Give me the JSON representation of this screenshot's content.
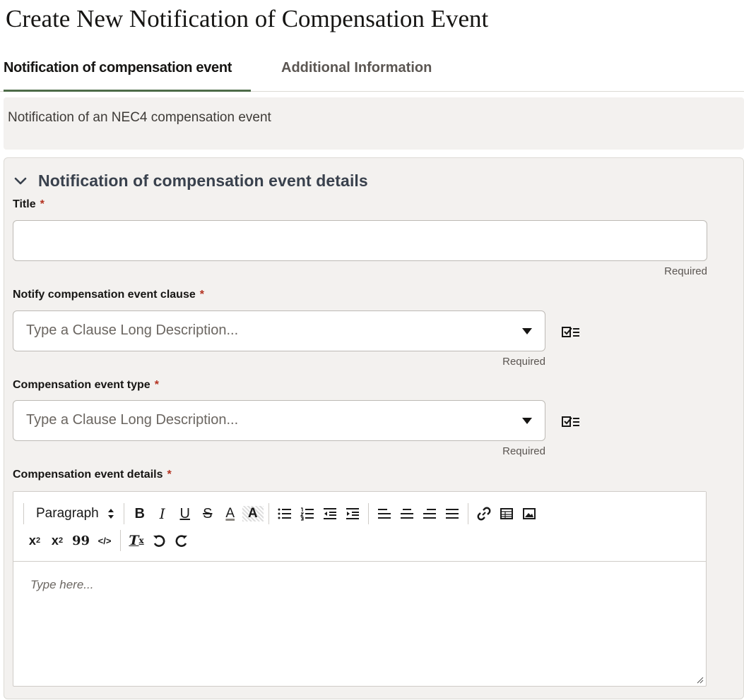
{
  "page": {
    "title": "Create New Notification of Compensation Event"
  },
  "tabs": [
    {
      "label": "Notification of compensation event",
      "active": true
    },
    {
      "label": "Additional Information",
      "active": false
    }
  ],
  "banner": {
    "text": "Notification of an NEC4 compensation event"
  },
  "section": {
    "title": "Notification of compensation event details",
    "expanded": true
  },
  "fields": {
    "title": {
      "label": "Title",
      "required_mark": "*",
      "value": "",
      "placeholder": "",
      "helper": "Required"
    },
    "clause": {
      "label": "Notify compensation event clause",
      "required_mark": "*",
      "placeholder": "Type a Clause Long Description...",
      "helper": "Required"
    },
    "event_type": {
      "label": "Compensation event type",
      "required_mark": "*",
      "placeholder": "Type a Clause Long Description...",
      "helper": "Required"
    },
    "details": {
      "label": "Compensation event details",
      "required_mark": "*",
      "placeholder": "Type here..."
    }
  },
  "editor": {
    "paragraph_label": "Paragraph",
    "toolbar_icons": [
      "bold-icon",
      "italic-icon",
      "underline-icon",
      "strikethrough-icon",
      "font-color-icon",
      "highlight-icon",
      "bullet-list-icon",
      "numbered-list-icon",
      "outdent-icon",
      "indent-icon",
      "align-left-icon",
      "align-center-icon",
      "align-right-icon",
      "align-justify-icon",
      "link-icon",
      "table-icon",
      "image-icon",
      "subscript-icon",
      "superscript-icon",
      "blockquote-icon",
      "code-icon",
      "clear-formatting-icon",
      "undo-icon",
      "redo-icon"
    ],
    "glyphs": {
      "bold": "B",
      "italic": "I",
      "underline": "U",
      "strike": "S",
      "color": "A",
      "highlight": "A",
      "subscript": "x",
      "sub_mark": "2",
      "superscript": "x",
      "sup_mark": "2",
      "quote": "99",
      "code": "</>",
      "clear": "T",
      "clear_mark": "x"
    }
  },
  "colors": {
    "tab_underline": "#4d6b48",
    "required_star": "#b3311f",
    "section_title": "#39414d",
    "panel_bg": "#f3f1ef"
  }
}
